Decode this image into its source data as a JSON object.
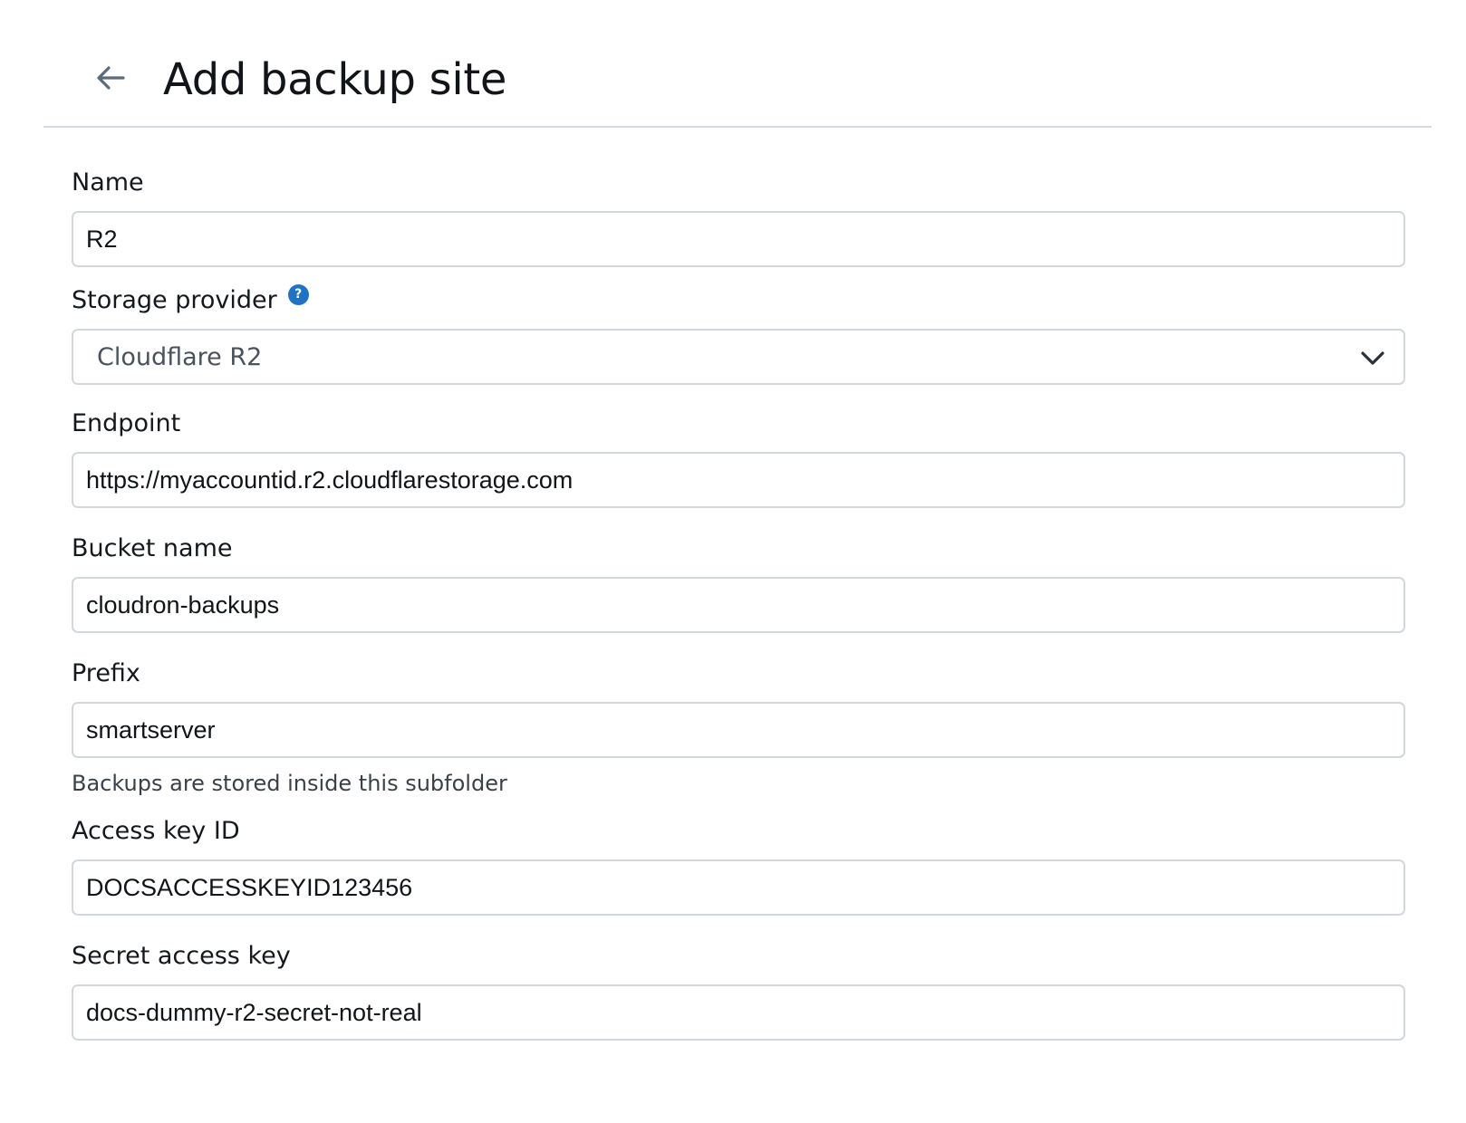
{
  "header": {
    "back_icon": "arrow-left-icon",
    "title": "Add backup site"
  },
  "form": {
    "name": {
      "label": "Name",
      "value": "R2"
    },
    "storage_provider": {
      "label": "Storage provider",
      "help_icon": "question-circle-icon",
      "help_glyph": "?",
      "selected": "Cloudflare R2",
      "dropdown_icon": "chevron-down-icon"
    },
    "endpoint": {
      "label": "Endpoint",
      "value": "https://myaccountid.r2.cloudflarestorage.com"
    },
    "bucket_name": {
      "label": "Bucket name",
      "value": "cloudron-backups"
    },
    "prefix": {
      "label": "Prefix",
      "value": "smartserver",
      "hint": "Backups are stored inside this subfolder"
    },
    "access_key_id": {
      "label": "Access key ID",
      "value": "DOCSACCESSKEYID123456"
    },
    "secret_access_key": {
      "label": "Secret access key",
      "value": "docs-dummy-r2-secret-not-real"
    }
  },
  "colors": {
    "accent": "#1f72c4",
    "border": "#d3d7dc",
    "text": "#111418",
    "muted_text": "#3a4149"
  }
}
